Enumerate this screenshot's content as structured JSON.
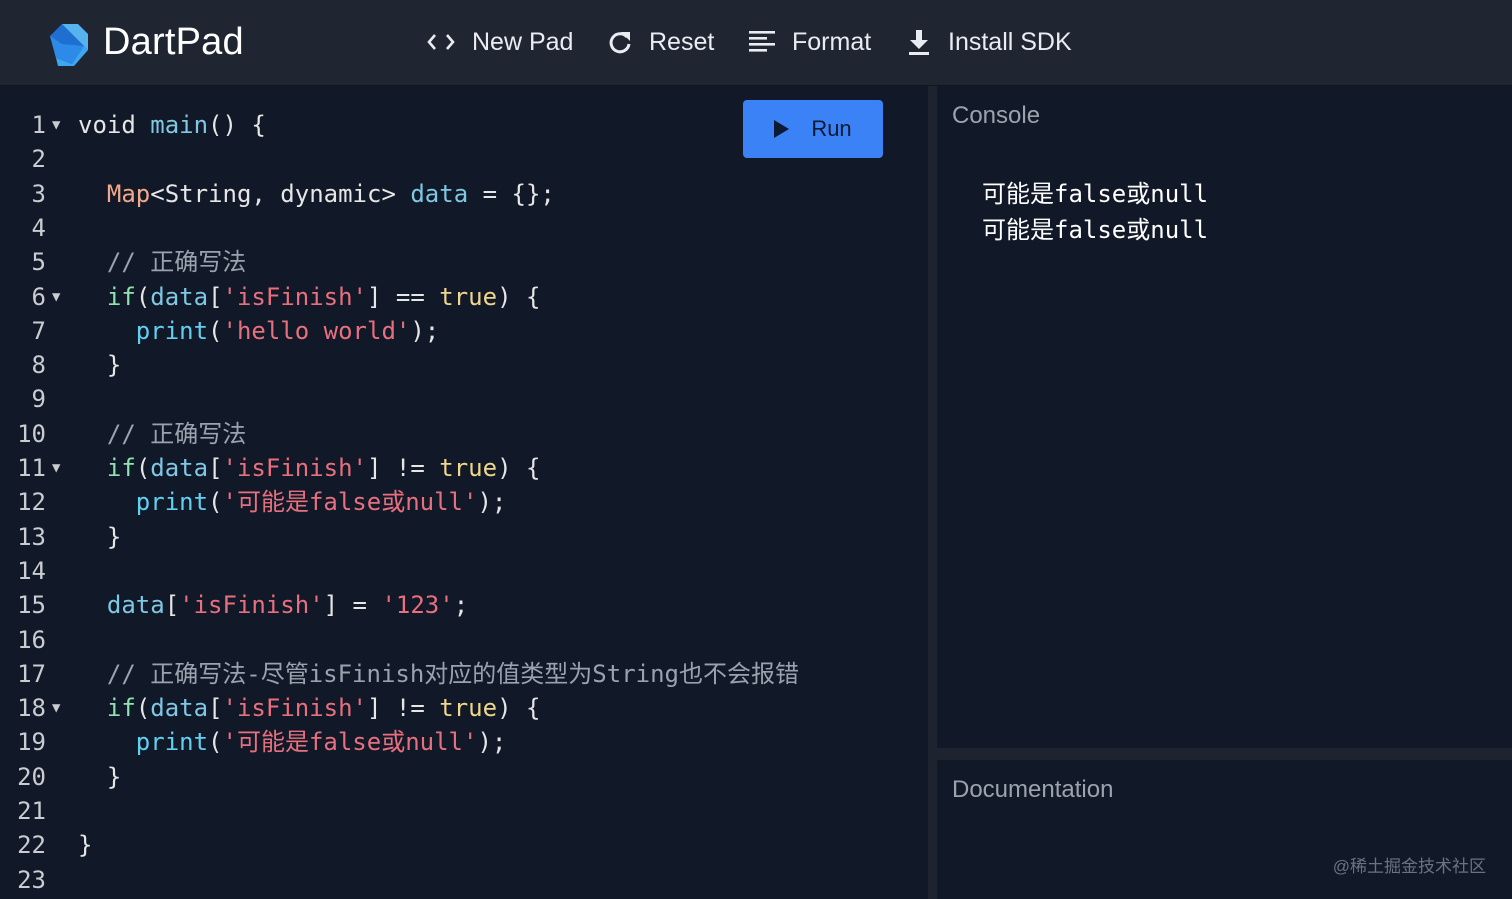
{
  "app": {
    "title": "DartPad"
  },
  "toolbar": {
    "new_pad": "New Pad",
    "reset": "Reset",
    "format": "Format",
    "install_sdk": "Install SDK"
  },
  "run_button": "Run",
  "editor": {
    "lines": [
      {
        "n": "1",
        "fold": true,
        "tokens": [
          [
            "op",
            "void "
          ],
          [
            "fn",
            "main"
          ],
          [
            "op",
            "() {"
          ]
        ]
      },
      {
        "n": "2",
        "fold": false,
        "tokens": []
      },
      {
        "n": "3",
        "fold": false,
        "tokens": [
          [
            "op",
            "  "
          ],
          [
            "ty",
            "Map"
          ],
          [
            "op",
            "<String, dynamic> "
          ],
          [
            "var",
            "data"
          ],
          [
            "op",
            " = {};"
          ]
        ]
      },
      {
        "n": "4",
        "fold": false,
        "tokens": []
      },
      {
        "n": "5",
        "fold": false,
        "tokens": [
          [
            "op",
            "  "
          ],
          [
            "cm",
            "// 正确写法"
          ]
        ]
      },
      {
        "n": "6",
        "fold": true,
        "tokens": [
          [
            "op",
            "  "
          ],
          [
            "ctl",
            "if"
          ],
          [
            "op",
            "("
          ],
          [
            "var",
            "data"
          ],
          [
            "op",
            "["
          ],
          [
            "str",
            "'isFinish'"
          ],
          [
            "op",
            "] == "
          ],
          [
            "kw",
            "true"
          ],
          [
            "op",
            ") {"
          ]
        ]
      },
      {
        "n": "7",
        "fold": false,
        "tokens": [
          [
            "op",
            "    "
          ],
          [
            "pr",
            "print"
          ],
          [
            "op",
            "("
          ],
          [
            "str",
            "'hello world'"
          ],
          [
            "op",
            ");"
          ]
        ]
      },
      {
        "n": "8",
        "fold": false,
        "tokens": [
          [
            "op",
            "  }"
          ]
        ]
      },
      {
        "n": "9",
        "fold": false,
        "tokens": []
      },
      {
        "n": "10",
        "fold": false,
        "tokens": [
          [
            "op",
            "  "
          ],
          [
            "cm",
            "// 正确写法"
          ]
        ]
      },
      {
        "n": "11",
        "fold": true,
        "tokens": [
          [
            "op",
            "  "
          ],
          [
            "ctl",
            "if"
          ],
          [
            "op",
            "("
          ],
          [
            "var",
            "data"
          ],
          [
            "op",
            "["
          ],
          [
            "str",
            "'isFinish'"
          ],
          [
            "op",
            "] != "
          ],
          [
            "kw",
            "true"
          ],
          [
            "op",
            ") {"
          ]
        ]
      },
      {
        "n": "12",
        "fold": false,
        "tokens": [
          [
            "op",
            "    "
          ],
          [
            "pr",
            "print"
          ],
          [
            "op",
            "("
          ],
          [
            "str",
            "'可能是false或null'"
          ],
          [
            "op",
            ");"
          ]
        ]
      },
      {
        "n": "13",
        "fold": false,
        "tokens": [
          [
            "op",
            "  }"
          ]
        ]
      },
      {
        "n": "14",
        "fold": false,
        "tokens": []
      },
      {
        "n": "15",
        "fold": false,
        "tokens": [
          [
            "op",
            "  "
          ],
          [
            "var",
            "data"
          ],
          [
            "op",
            "["
          ],
          [
            "str",
            "'isFinish'"
          ],
          [
            "op",
            "] = "
          ],
          [
            "str",
            "'123'"
          ],
          [
            "op",
            ";"
          ]
        ]
      },
      {
        "n": "16",
        "fold": false,
        "tokens": []
      },
      {
        "n": "17",
        "fold": false,
        "tokens": [
          [
            "op",
            "  "
          ],
          [
            "cm",
            "// 正确写法-尽管isFinish对应的值类型为String也不会报错"
          ]
        ]
      },
      {
        "n": "18",
        "fold": true,
        "tokens": [
          [
            "op",
            "  "
          ],
          [
            "ctl",
            "if"
          ],
          [
            "op",
            "("
          ],
          [
            "var",
            "data"
          ],
          [
            "op",
            "["
          ],
          [
            "str",
            "'isFinish'"
          ],
          [
            "op",
            "] != "
          ],
          [
            "kw",
            "true"
          ],
          [
            "op",
            ") {"
          ]
        ]
      },
      {
        "n": "19",
        "fold": false,
        "tokens": [
          [
            "op",
            "    "
          ],
          [
            "pr",
            "print"
          ],
          [
            "op",
            "("
          ],
          [
            "str",
            "'可能是false或null'"
          ],
          [
            "op",
            ");"
          ]
        ]
      },
      {
        "n": "20",
        "fold": false,
        "tokens": [
          [
            "op",
            "  }"
          ]
        ]
      },
      {
        "n": "21",
        "fold": false,
        "tokens": []
      },
      {
        "n": "22",
        "fold": false,
        "tokens": [
          [
            "op",
            "}"
          ]
        ]
      },
      {
        "n": "23",
        "fold": false,
        "tokens": []
      }
    ]
  },
  "console": {
    "title": "Console",
    "output": [
      "可能是false或null",
      "可能是false或null"
    ]
  },
  "documentation": {
    "title": "Documentation"
  },
  "watermark": "@稀土掘金技术社区"
}
